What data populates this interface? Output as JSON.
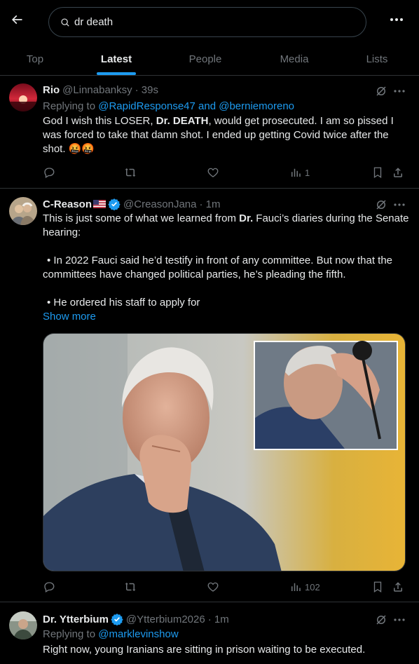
{
  "search": {
    "query": "dr death"
  },
  "tabs": [
    "Top",
    "Latest",
    "People",
    "Media",
    "Lists"
  ],
  "active_tab": "Latest",
  "tweets": [
    {
      "name": "Rio",
      "handle": "@Linnabanksy",
      "time": "· 39s",
      "replying_prefix": "Replying to ",
      "replying_to": "@RapidResponse47 and @berniemoreno",
      "text_parts": [
        "God I wish this LOSER, ",
        "Dr. DEATH",
        ", would get prosecuted. I am so pissed I was forced to take that damn shot. I ended up getting Covid twice after the shot. 🤬🤬"
      ],
      "views": "1"
    },
    {
      "name": "C-Reason",
      "handle": "@CreasonJana",
      "time": "· 1m",
      "text_line1_a": "This is just some of what we learned from ",
      "text_line1_b": "Dr.",
      "text_line1_c": " Fauci’s diaries during the Senate hearing:",
      "text_para2": "• In 2022 Fauci said he’d testify in front of any committee. But now that the committees have changed political parties, he’s pleading the fifth.",
      "text_para3": "• He ordered his staff to apply for",
      "show_more": "Show more",
      "views": "102"
    },
    {
      "name": "Dr. Ytterbium",
      "handle": "@Ytterbium2026",
      "time": "· 1m",
      "replying_prefix": "Replying to ",
      "replying_to": "@marklevinshow",
      "text": "Right now, young Iranians are sitting in prison waiting to be executed."
    }
  ],
  "colors": {
    "accent": "#1d9bf0",
    "muted": "#71767b",
    "text": "#e7e9ea",
    "border": "#2f3336"
  }
}
